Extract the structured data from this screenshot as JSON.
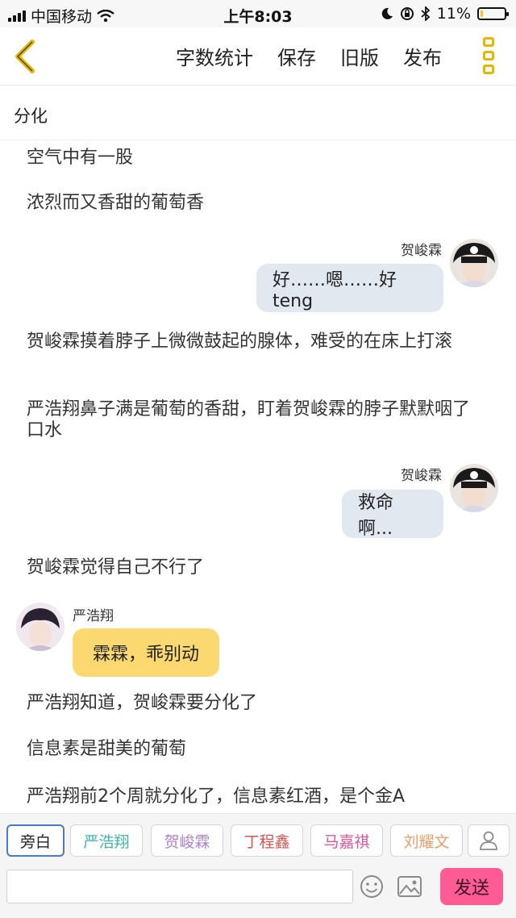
{
  "status_bar": {
    "carrier": "中国移动",
    "time": "上午8:03",
    "battery_text": "11%",
    "battery_level": 0.11
  },
  "toolbar": {
    "word_count": "字数统计",
    "save": "保存",
    "old_version": "旧版",
    "publish": "发布"
  },
  "chapter": {
    "title": "分化"
  },
  "content": {
    "n1": "空气中有一股",
    "n2": "浓烈而又香甜的葡萄香",
    "m1_name": "贺峻霖",
    "m1_text": "好……嗯……好teng",
    "n3": "贺峻霖摸着脖子上微微鼓起的腺体，难受的在床上打滚",
    "n4": "严浩翔鼻子满是葡萄的香甜，盯着贺峻霖的脖子默默咽了口水",
    "m2_name": "贺峻霖",
    "m2_text": "救命啊...",
    "n5": "贺峻霖觉得自己不行了",
    "m3_name": "严浩翔",
    "m3_text": "霖霖，乖别动",
    "n6": "严浩翔知道，贺峻霖要分化了",
    "n7": "信息素是甜美的葡萄",
    "n8": "严浩翔前2个周就分化了，信息素红酒，是个金A"
  },
  "characters": [
    {
      "label": "旁白",
      "color": "#222222",
      "active": true
    },
    {
      "label": "严浩翔",
      "color": "#3bb8a6",
      "active": false
    },
    {
      "label": "贺峻霖",
      "color": "#b07fcf",
      "active": false
    },
    {
      "label": "丁程鑫",
      "color": "#d9534f",
      "active": false
    },
    {
      "label": "马嘉祺",
      "color": "#e0559a",
      "active": false
    },
    {
      "label": "刘耀文",
      "color": "#e7a06a",
      "active": false
    }
  ],
  "input": {
    "placeholder": "",
    "send_label": "发送"
  },
  "colors": {
    "accent_yellow": "#e5b800",
    "send_pink": "#ff5c96",
    "bubble_right": "#e2e8ef",
    "bubble_left": "#fbd870"
  }
}
